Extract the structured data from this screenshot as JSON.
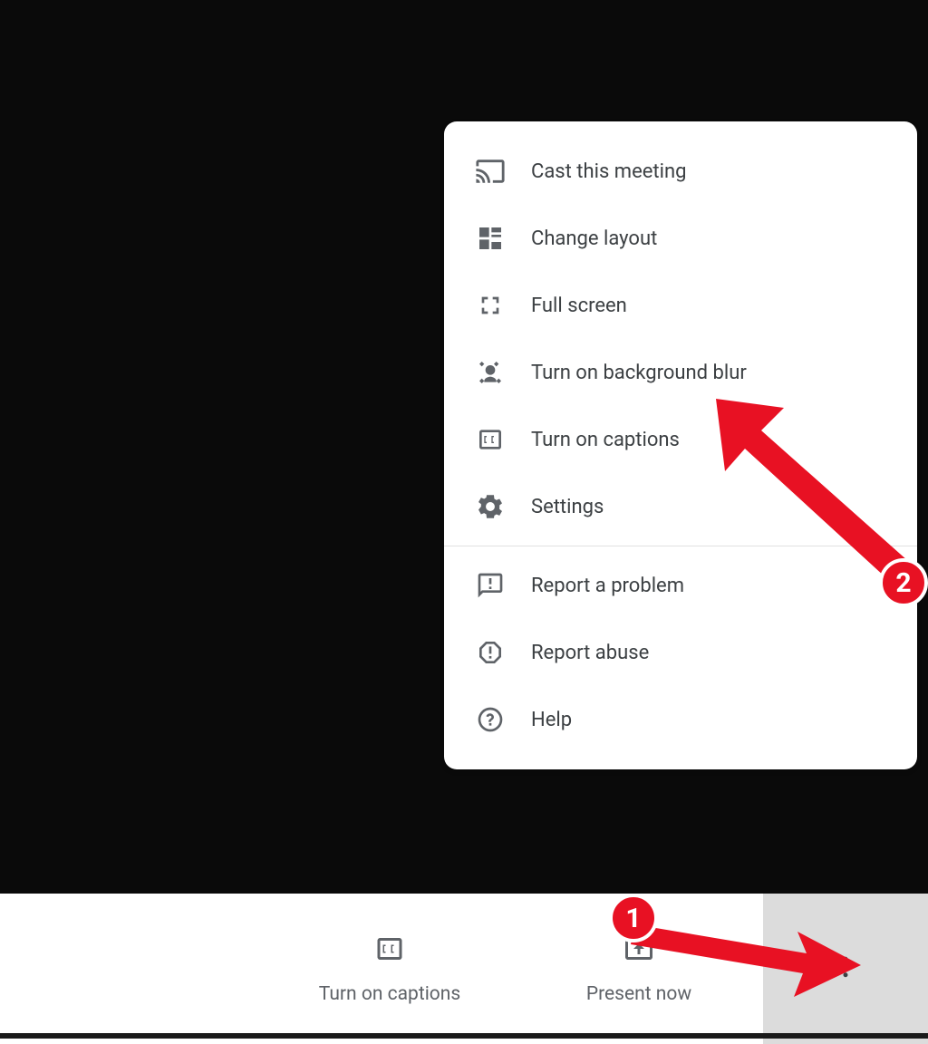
{
  "menu": {
    "items": [
      {
        "label": "Cast this meeting",
        "icon": "cast-icon"
      },
      {
        "label": "Change layout",
        "icon": "layout-icon"
      },
      {
        "label": "Full screen",
        "icon": "fullscreen-icon"
      },
      {
        "label": "Turn on background blur",
        "icon": "blur-icon"
      },
      {
        "label": "Turn on captions",
        "icon": "captions-icon"
      },
      {
        "label": "Settings",
        "icon": "settings-icon"
      }
    ],
    "items2": [
      {
        "label": "Report a problem",
        "icon": "feedback-icon"
      },
      {
        "label": "Report abuse",
        "icon": "report-abuse-icon"
      },
      {
        "label": "Help",
        "icon": "help-icon"
      }
    ]
  },
  "toolbar": {
    "captions_label": "Turn on captions",
    "present_label": "Present now"
  },
  "annotations": {
    "badge1": "1",
    "badge2": "2",
    "color": "#e81123"
  }
}
